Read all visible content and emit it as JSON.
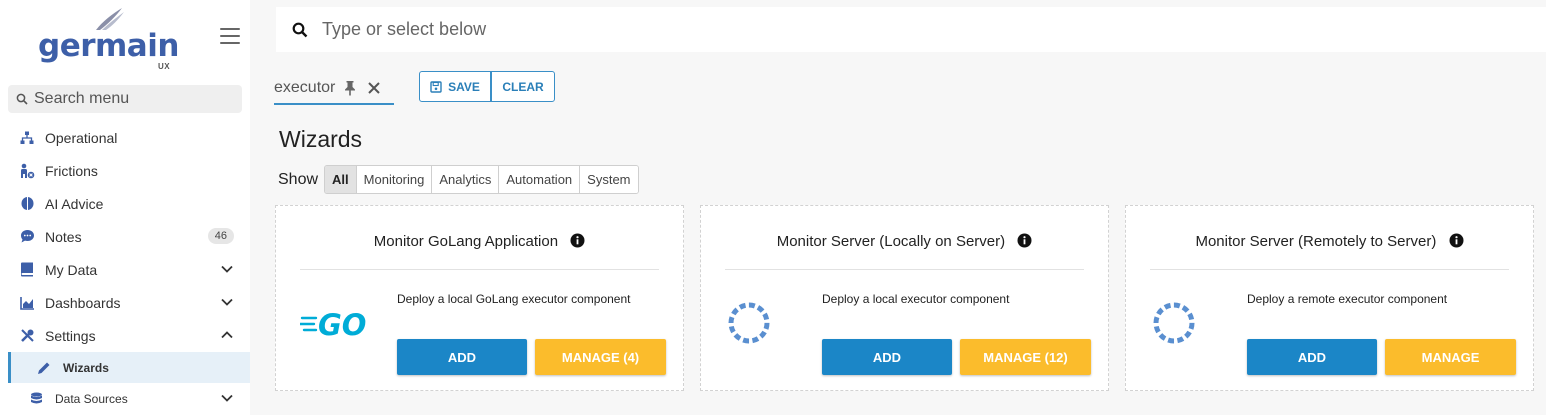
{
  "sidebar": {
    "logo_text": "germain",
    "logo_sub": "UX",
    "search_placeholder": "Search menu",
    "items": [
      {
        "label": "Operational"
      },
      {
        "label": "Frictions"
      },
      {
        "label": "AI Advice"
      },
      {
        "label": "Notes",
        "badge": "46"
      },
      {
        "label": "My Data"
      },
      {
        "label": "Dashboards"
      },
      {
        "label": "Settings"
      }
    ],
    "subitems": [
      {
        "label": "Wizards"
      },
      {
        "label": "Data Sources"
      }
    ]
  },
  "search": {
    "placeholder": "Type or select below"
  },
  "filter": {
    "chip": "executor"
  },
  "actions": {
    "save": "SAVE",
    "clear": "CLEAR"
  },
  "main": {
    "title": "Wizards",
    "show_label": "Show",
    "filters": [
      "All",
      "Monitoring",
      "Analytics",
      "Automation",
      "System"
    ]
  },
  "cards": [
    {
      "title": "Monitor GoLang Application",
      "description": "Deploy a local GoLang executor component",
      "add": "ADD",
      "manage": "MANAGE (4)",
      "logo": "GO"
    },
    {
      "title": "Monitor Server (Locally on Server)",
      "description": "Deploy a local executor component",
      "add": "ADD",
      "manage": "MANAGE (12)"
    },
    {
      "title": "Monitor Server (Remotely to Server)",
      "description": "Deploy a remote executor component",
      "add": "ADD",
      "manage": "MANAGE"
    }
  ],
  "colors": {
    "primary": "#1b86c7",
    "accent": "#fbbc2c",
    "brand": "#3d5fa8",
    "gopher": "#00acd7"
  }
}
